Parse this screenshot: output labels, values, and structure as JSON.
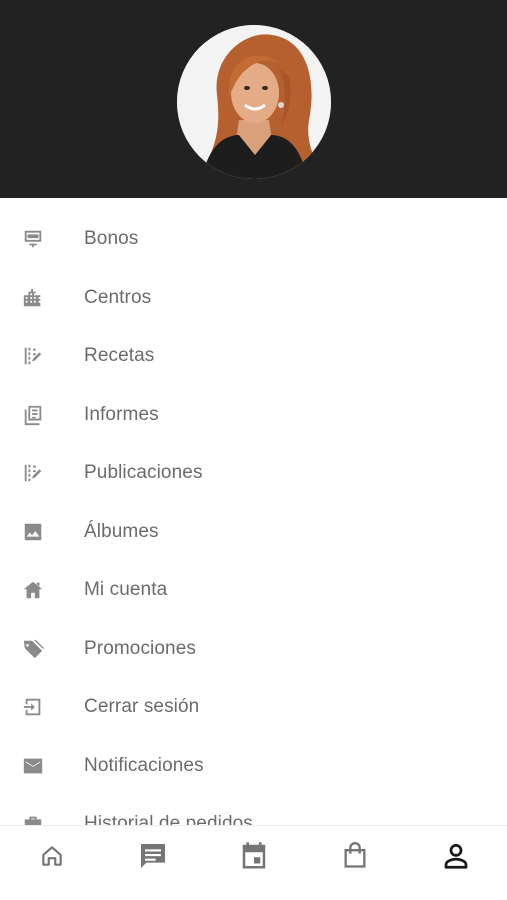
{
  "profile": {
    "avatar_alt": "Foto de perfil"
  },
  "menu": {
    "items": [
      {
        "label": "Bonos",
        "icon": "ticket-icon"
      },
      {
        "label": "Centros",
        "icon": "buildings-icon"
      },
      {
        "label": "Recetas",
        "icon": "prescription-icon"
      },
      {
        "label": "Informes",
        "icon": "report-icon"
      },
      {
        "label": "Publicaciones",
        "icon": "publications-icon"
      },
      {
        "label": "Álbumes",
        "icon": "image-icon"
      },
      {
        "label": "Mi cuenta",
        "icon": "account-home-icon"
      },
      {
        "label": "Promociones",
        "icon": "tag-icon"
      },
      {
        "label": "Cerrar sesión",
        "icon": "logout-icon"
      },
      {
        "label": "Notificaciones",
        "icon": "mail-icon"
      },
      {
        "label": "Historial de pedidos",
        "icon": "orders-icon"
      }
    ]
  },
  "bottom_nav": {
    "items": [
      {
        "icon": "home-icon",
        "active": false
      },
      {
        "icon": "chat-icon",
        "active": false
      },
      {
        "icon": "calendar-icon",
        "active": false
      },
      {
        "icon": "shopping-bag-icon",
        "active": false
      },
      {
        "icon": "person-icon",
        "active": true
      }
    ]
  },
  "colors": {
    "header_bg": "#222222",
    "menu_text": "#6b6b6b",
    "icon": "#8a8a8a",
    "nav_icon": "#757575",
    "nav_active": "#1a1a1a"
  }
}
